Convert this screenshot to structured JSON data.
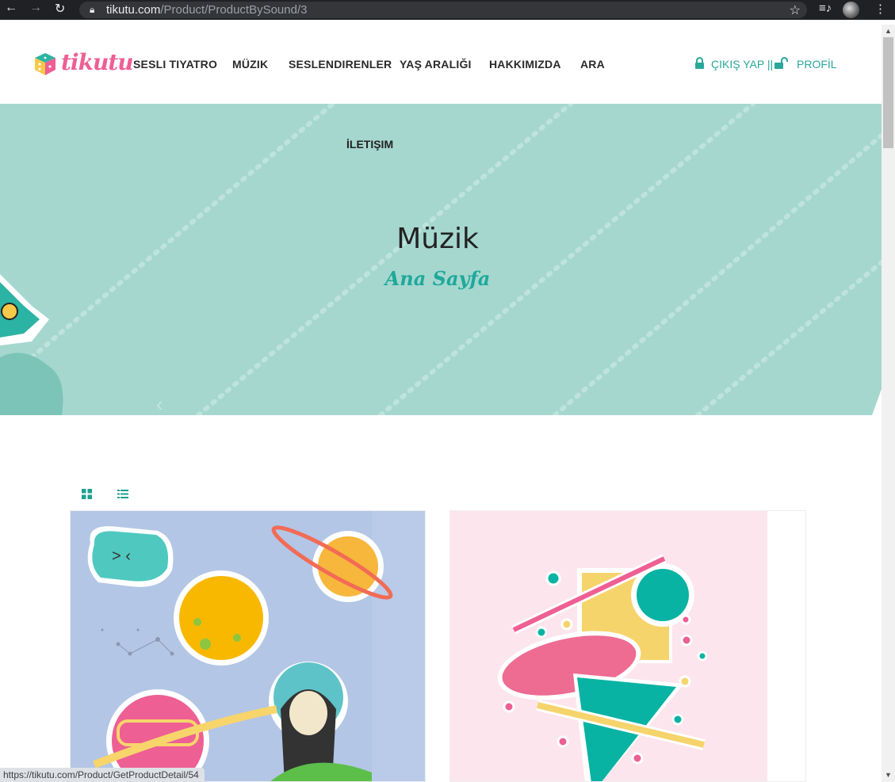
{
  "browser": {
    "url_domain": "tikutu.com",
    "url_path": "/Product/ProductBySound/3",
    "status_link": "https://tikutu.com/Product/GetProductDetail/54"
  },
  "header": {
    "logo_text": "tikutu",
    "menu": [
      "SESLI TIYATRO",
      "MÜZIK",
      "SESLENDIRENLER",
      "YAŞ ARALIĞI",
      "HAKKIMIZDA",
      "ARA"
    ],
    "logout_label": "ÇIKIŞ YAP ||",
    "profile_label": "PROFİL"
  },
  "hero": {
    "contact_label": "İLETIŞIM",
    "title": "Müzik",
    "breadcrumb": "Ana Sayfa"
  },
  "colors": {
    "accent": "#1fa99a",
    "hero_bg": "#a5d7cf",
    "brand_pink": "#ee5f93"
  },
  "icons": {
    "grid_view": "grid-icon",
    "list_view": "list-icon",
    "lock": "lock-icon",
    "unlock": "unlock-icon"
  }
}
